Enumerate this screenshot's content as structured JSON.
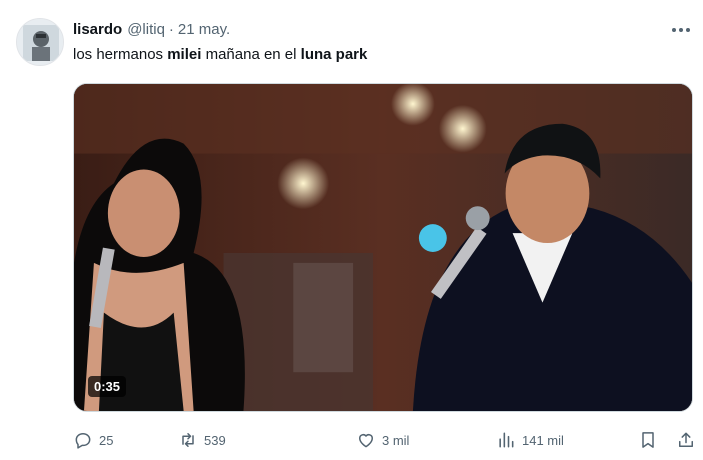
{
  "author": {
    "display_name": "lisardo",
    "handle": "@litiq",
    "separator": "·",
    "date": "21 may."
  },
  "tweet": {
    "text_parts": [
      "los hermanos ",
      "milei",
      " mañana en el ",
      "luna park"
    ]
  },
  "media": {
    "type": "video",
    "duration": "0:35"
  },
  "actions": {
    "replies": "25",
    "retweets": "539",
    "likes": "3 mil",
    "views": "141 mil"
  },
  "icons": {
    "more": "more-horizontal-icon",
    "reply": "reply-icon",
    "retweet": "retweet-icon",
    "like": "heart-icon",
    "views": "views-icon",
    "bookmark": "bookmark-icon",
    "share": "share-icon"
  },
  "colors": {
    "text_primary": "#0f1419",
    "text_secondary": "#536471",
    "border": "#cfd9de"
  }
}
